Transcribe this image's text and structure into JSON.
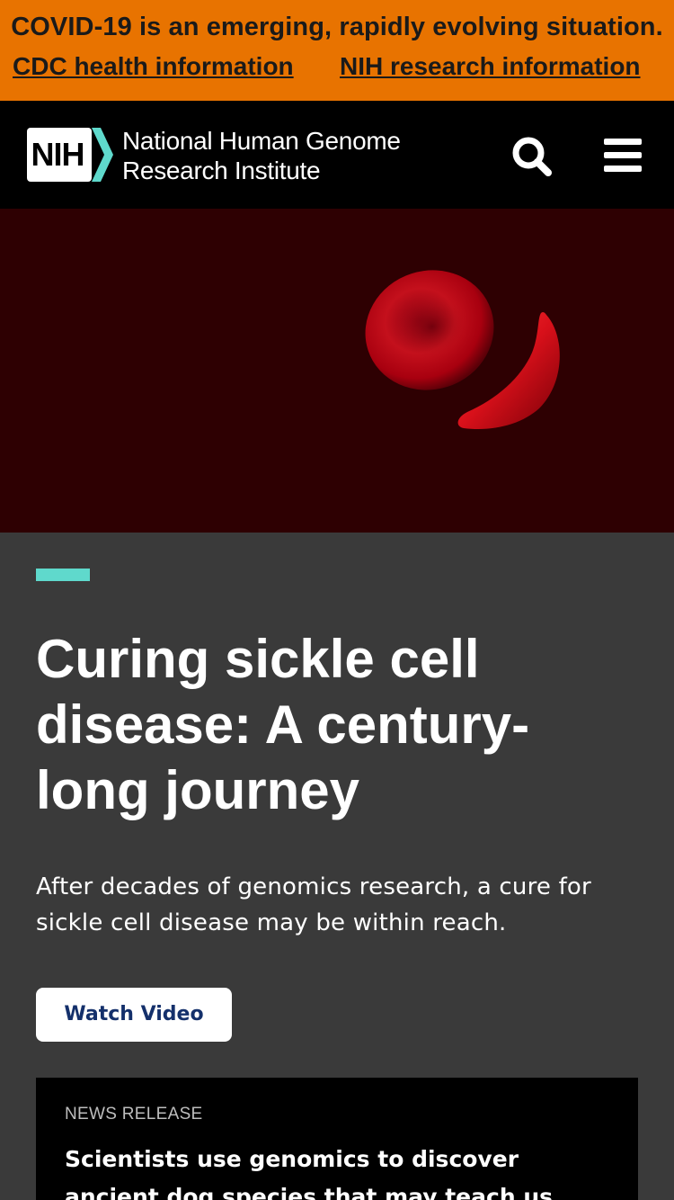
{
  "covid_banner": {
    "message": "COVID-19 is an emerging, rapidly evolving situation.",
    "links": [
      "CDC health information",
      "NIH research information"
    ],
    "background": "#e87300"
  },
  "header": {
    "logo_text": "NIH",
    "org_name_line1": "National Human Genome",
    "org_name_line2": "Research Institute",
    "icons": [
      "search-icon",
      "hamburger-menu-icon"
    ]
  },
  "hero": {
    "image_alt": "red blood cell and sickle cell",
    "title": "Curing sickle cell disease: A century-long journey",
    "description": "After decades of genomics research, a cure for sickle cell disease may be within reach.",
    "button_label": "Watch Video",
    "accent_color": "#5fd9cc"
  },
  "news": {
    "label": "NEWS RELEASE",
    "title": "Scientists use genomics to discover ancient dog species that may teach us about human"
  }
}
